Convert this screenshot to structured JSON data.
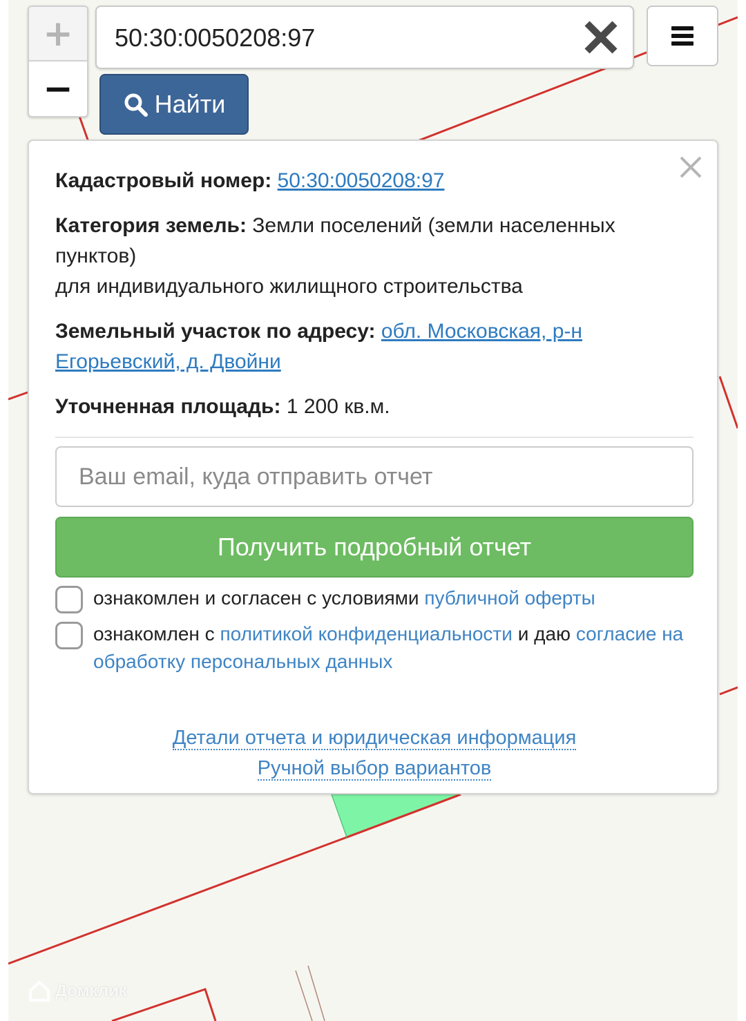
{
  "search": {
    "value": "50:30:0050208:97",
    "find_label": "Найти"
  },
  "zoom": {
    "in": "+",
    "out": "−"
  },
  "icons": {
    "clear": "close-icon",
    "menu": "hamburger-menu-icon",
    "find": "search-icon",
    "panel_close": "close-icon"
  },
  "panel": {
    "cadastral_label": "Кадастровый номер:",
    "cadastral_value": "50:30:0050208:97",
    "category_label": "Категория земель:",
    "category_value": "Земли поселений (земли населенных пунктов)",
    "usage": "для индивидуального жилищного строительства",
    "address_label": "Земельный участок по адресу:",
    "address_value": "обл. Московская, р-н Егорьевский, д. Двойни",
    "area_label": "Уточненная площадь:",
    "area_value": "1 200 кв.м.",
    "email_placeholder": "Ваш email, куда отправить отчет",
    "report_button": "Получить подробный отчет",
    "consent1_text": "ознакомлен и согласен с условиями",
    "consent1_link": "публичной оферты",
    "consent2_text_a": "ознакомлен с",
    "consent2_link_a": "политикой конфиденциальности",
    "consent2_text_b": "и даю",
    "consent2_link_b": "согласие на обработку персональных данных",
    "link_details": "Детали отчета и юридическая информация",
    "link_manual": "Ручной выбор вариантов"
  },
  "watermark": "Домклик",
  "colors": {
    "find_button": "#3d6698",
    "report_button": "#6dbb62",
    "link": "#2e7bbf",
    "parcel_fill": "#7ef5a6",
    "boundary": "#d2322d"
  }
}
